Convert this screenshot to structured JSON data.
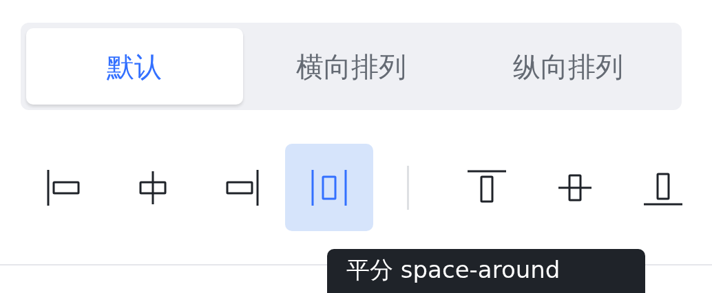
{
  "tabs": [
    {
      "label": "默认",
      "selected": true
    },
    {
      "label": "横向排列",
      "selected": false
    },
    {
      "label": "纵向排列",
      "selected": false
    }
  ],
  "align_groups": [
    [
      {
        "kind": "left",
        "selected": false
      },
      {
        "kind": "center",
        "selected": false
      },
      {
        "kind": "right",
        "selected": false
      },
      {
        "kind": "space-around",
        "selected": true
      }
    ],
    [
      {
        "kind": "top",
        "selected": false
      },
      {
        "kind": "middle",
        "selected": false
      },
      {
        "kind": "bottom",
        "selected": false
      }
    ]
  ],
  "tooltip": "平分 space-around"
}
